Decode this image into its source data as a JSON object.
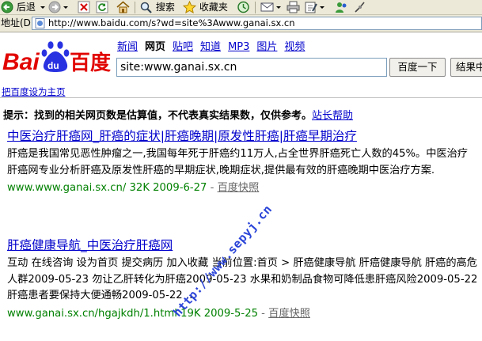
{
  "toolbar": {
    "back_label": "后退",
    "search_label": "搜索",
    "favorites_label": "收藏夹"
  },
  "address_bar": {
    "label": "地址(D)",
    "url": "http://www.baidu.com/s?wd=site%3Awww.ganai.sx.cn"
  },
  "nav": {
    "tabs": [
      "新闻",
      "网页",
      "贴吧",
      "知道",
      "MP3",
      "图片",
      "视频"
    ],
    "active": "网页"
  },
  "search": {
    "query": "site:www.ganai.sx.cn",
    "button_label": "百度一下",
    "button2_label": "结果中找"
  },
  "logo": {
    "text": "Bai百度",
    "accent": "#e10602",
    "paw": "#2932e1"
  },
  "set_home_link": "把百度设为主页",
  "hint": {
    "text": "提示：找到的相关网页数是估算值，不代表真实结果数，仅供参考。",
    "link": "站长帮助"
  },
  "results": [
    {
      "title": "中医治疗肝癌网_肝癌的症状|肝癌晚期|原发性肝癌|肝癌早期治疗",
      "abstract": "肝癌是我国常见恶性肿瘤之一,我国每年死于肝癌约11万人,占全世界肝癌死亡人数的45%。中医治疗肝癌网专业分析肝癌及原发性肝癌的早期症状,晚期症状,提供最有效的肝癌晚期中医治疗方案.",
      "url_line": "www.www.ganai.sx.cn/ 32K 2009-6-27",
      "dash": " - ",
      "cache": "百度快照"
    },
    {
      "title": "肝癌健康导航_中医治疗肝癌网",
      "abstract": "互动 在线咨询 设为首页 提交病历 加入收藏 当前位置:首页 > 肝癌健康导航 肝癌健康导航 肝癌的高危人群2009-05-23 勿让乙肝转化为肝癌2009-05-23 水果和奶制品食物可降低患肝癌风险2009-05-22 肝癌患者要保持大便通畅2009-05-22 ...",
      "url_line": "www.ganai.sx.cn/hgajkdh/1.html 19K 2009-5-25",
      "dash": " - ",
      "cache": "百度快照"
    }
  ],
  "watermark": "http://www.sepyj.cn"
}
